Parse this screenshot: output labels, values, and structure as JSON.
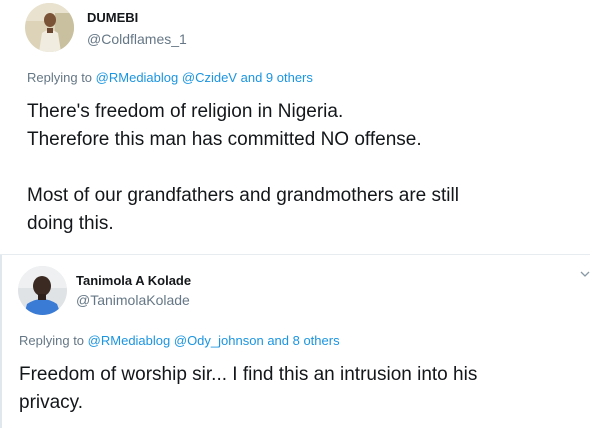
{
  "tweets": [
    {
      "display_name": "DUMEBI",
      "handle": "@Coldflames_1",
      "replying": {
        "prefix": "Replying to",
        "mentions": [
          "@RMediablog",
          "@CzideV"
        ],
        "others": "and 9 others"
      },
      "text_lines": [
        "There's freedom of religion in Nigeria.",
        "Therefore this man has committed NO offense."
      ],
      "text_lines_2": [
        "Most of our grandfathers and grandmothers are still",
        "doing this."
      ]
    },
    {
      "display_name": "Tanimola A Kolade",
      "handle": "@TanimolaKolade",
      "replying": {
        "prefix": "Replying to",
        "mentions": [
          "@RMediablog",
          "@Ody_johnson"
        ],
        "others": "and 8 others"
      },
      "text_lines": [
        "Freedom of worship sir... I find this an intrusion into his",
        "privacy."
      ],
      "menu_icon": "chevron-down-icon"
    }
  ],
  "colors": {
    "text": "#14171a",
    "secondary": "#657786",
    "link": "#1b95e0"
  }
}
